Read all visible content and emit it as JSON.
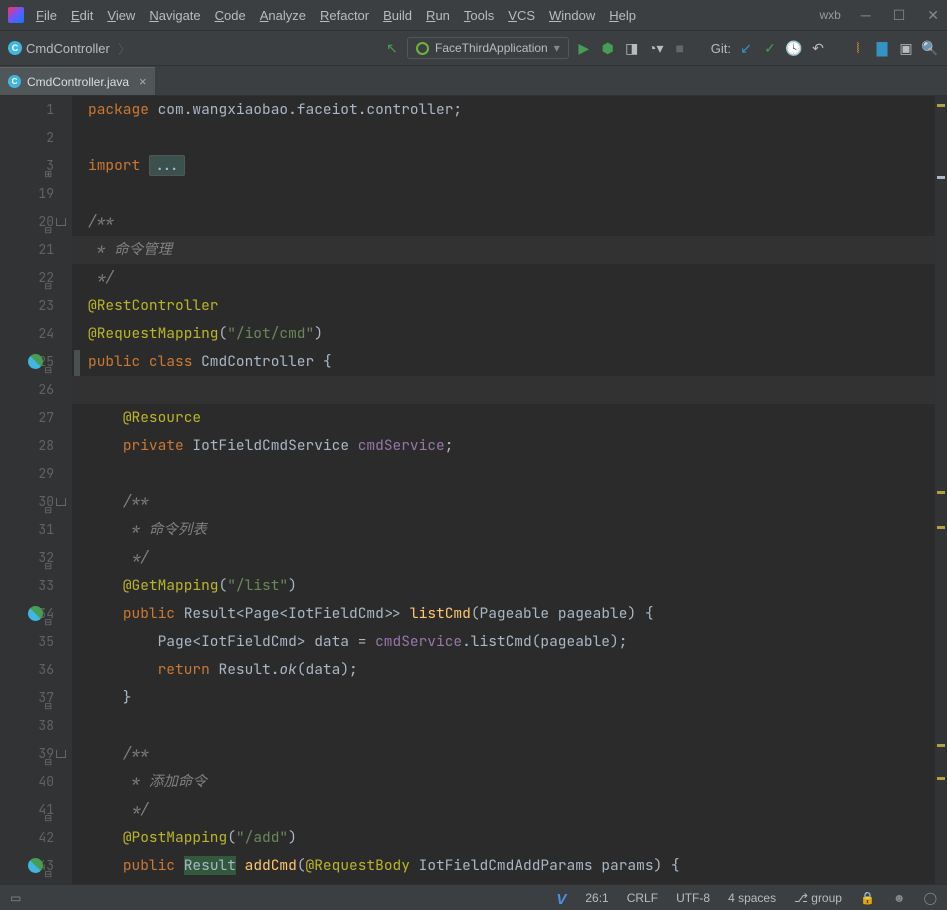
{
  "menu": [
    "File",
    "Edit",
    "View",
    "Navigate",
    "Code",
    "Analyze",
    "Refactor",
    "Build",
    "Run",
    "Tools",
    "VCS",
    "Window",
    "Help"
  ],
  "project_name": "wxb",
  "breadcrumb": "CmdController",
  "run_config": "FaceThirdApplication",
  "git_label": "Git:",
  "tab": {
    "name": "CmdController.java"
  },
  "lines": [
    {
      "n": 1,
      "t": [
        {
          "c": "kw",
          "s": "package "
        },
        {
          "s": "com.wangxiaobao.faceiot.controller;"
        }
      ]
    },
    {
      "n": 2,
      "t": []
    },
    {
      "n": 3,
      "t": [
        {
          "c": "kw",
          "s": "import "
        },
        {
          "c": "fold-box",
          "s": "..."
        }
      ],
      "fold": "+"
    },
    {
      "n": 19,
      "t": []
    },
    {
      "n": 20,
      "t": [
        {
          "c": "cmt",
          "s": "/**"
        }
      ],
      "bar": true,
      "fold": "-"
    },
    {
      "n": 21,
      "t": [
        {
          "c": "cmt",
          "s": " * 命令管理"
        }
      ],
      "hl": true
    },
    {
      "n": 22,
      "t": [
        {
          "c": "cmt",
          "s": " */"
        }
      ],
      "fold": "-"
    },
    {
      "n": 23,
      "t": [
        {
          "c": "ann",
          "s": "@RestController"
        }
      ]
    },
    {
      "n": 24,
      "t": [
        {
          "c": "ann",
          "s": "@RequestMapping"
        },
        {
          "s": "("
        },
        {
          "c": "str",
          "s": "\"/iot/cmd\""
        },
        {
          "s": ")"
        }
      ]
    },
    {
      "n": 25,
      "t": [
        {
          "c": "kw",
          "s": "public class "
        },
        {
          "s": "CmdController {"
        }
      ],
      "icon": "mix",
      "fold": "-"
    },
    {
      "n": 26,
      "t": [],
      "hl": true
    },
    {
      "n": 27,
      "t": [
        {
          "s": "    "
        },
        {
          "c": "ann",
          "s": "@Resource"
        }
      ]
    },
    {
      "n": 28,
      "t": [
        {
          "s": "    "
        },
        {
          "c": "kw",
          "s": "private "
        },
        {
          "s": "IotFieldCmdService "
        },
        {
          "c": "fld",
          "s": "cmdService"
        },
        {
          "s": ";"
        }
      ]
    },
    {
      "n": 29,
      "t": []
    },
    {
      "n": 30,
      "t": [
        {
          "s": "    "
        },
        {
          "c": "cmt",
          "s": "/**"
        }
      ],
      "bar": true,
      "fold": "-"
    },
    {
      "n": 31,
      "t": [
        {
          "s": "    "
        },
        {
          "c": "cmt",
          "s": " * 命令列表"
        }
      ]
    },
    {
      "n": 32,
      "t": [
        {
          "s": "    "
        },
        {
          "c": "cmt",
          "s": " */"
        }
      ],
      "fold": "-"
    },
    {
      "n": 33,
      "t": [
        {
          "s": "    "
        },
        {
          "c": "ann",
          "s": "@GetMapping"
        },
        {
          "s": "("
        },
        {
          "c": "str",
          "s": "\"/list\""
        },
        {
          "s": ")"
        }
      ]
    },
    {
      "n": 34,
      "t": [
        {
          "s": "    "
        },
        {
          "c": "kw",
          "s": "public "
        },
        {
          "s": "Result<Page<IotFieldCmd>> "
        },
        {
          "c": "fn",
          "s": "listCmd"
        },
        {
          "s": "(Pageable pageable) {"
        }
      ],
      "icon": "mix",
      "fold": "-"
    },
    {
      "n": 35,
      "t": [
        {
          "s": "        Page<IotFieldCmd> data = "
        },
        {
          "c": "fld",
          "s": "cmdService"
        },
        {
          "s": ".listCmd(pageable);"
        }
      ]
    },
    {
      "n": 36,
      "t": [
        {
          "s": "        "
        },
        {
          "c": "kw",
          "s": "return "
        },
        {
          "s": "Result."
        },
        {
          "c": "it",
          "s": "ok"
        },
        {
          "s": "(data);"
        }
      ]
    },
    {
      "n": 37,
      "t": [
        {
          "s": "    }"
        }
      ],
      "fold": "-"
    },
    {
      "n": 38,
      "t": []
    },
    {
      "n": 39,
      "t": [
        {
          "s": "    "
        },
        {
          "c": "cmt",
          "s": "/**"
        }
      ],
      "bar": true,
      "fold": "-"
    },
    {
      "n": 40,
      "t": [
        {
          "s": "    "
        },
        {
          "c": "cmt",
          "s": " * 添加命令"
        }
      ]
    },
    {
      "n": 41,
      "t": [
        {
          "s": "    "
        },
        {
          "c": "cmt",
          "s": " */"
        }
      ],
      "fold": "-"
    },
    {
      "n": 42,
      "t": [
        {
          "s": "    "
        },
        {
          "c": "ann",
          "s": "@PostMapping"
        },
        {
          "s": "("
        },
        {
          "c": "str",
          "s": "\"/add\""
        },
        {
          "s": ")"
        }
      ]
    },
    {
      "n": 43,
      "t": [
        {
          "s": "    "
        },
        {
          "c": "kw",
          "s": "public "
        },
        {
          "c": "",
          "s": "Result",
          "bg": true
        },
        {
          "s": " "
        },
        {
          "c": "fn",
          "s": "addCmd"
        },
        {
          "s": "("
        },
        {
          "c": "ann",
          "s": "@RequestBody"
        },
        {
          "s": " IotFieldCmdAddParams params) {"
        }
      ],
      "icon": "mix",
      "fold": "-"
    }
  ],
  "status": {
    "pos": "26:1",
    "eol": "CRLF",
    "enc": "UTF-8",
    "indent": "4 spaces",
    "branch": "group"
  }
}
